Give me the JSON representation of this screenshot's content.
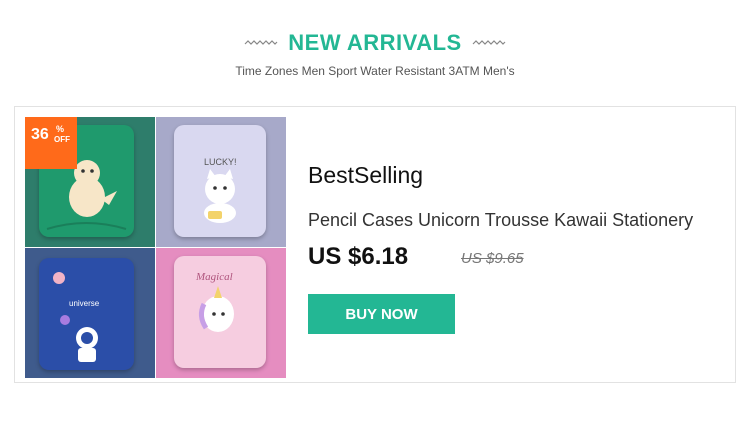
{
  "header": {
    "title": "NEW ARRIVALS",
    "subtitle": "Time Zones Men Sport Water Resistant 3ATM Men's"
  },
  "product": {
    "brand": "BestSelling",
    "name": "Pencil Cases Unicorn Trousse Kawaii Stationery",
    "price": "US $6.18",
    "original_price": "US $9.65",
    "discount_badge": {
      "percent": "36",
      "percent_sign": "%",
      "off": "OFF"
    },
    "buy_label": "BUY NOW",
    "image_labels": {
      "top_right": "LUCKY!",
      "bottom_left": "universe",
      "bottom_right": "Magical"
    }
  },
  "colors": {
    "accent": "#23b794",
    "badge": "#ff6a1a"
  }
}
